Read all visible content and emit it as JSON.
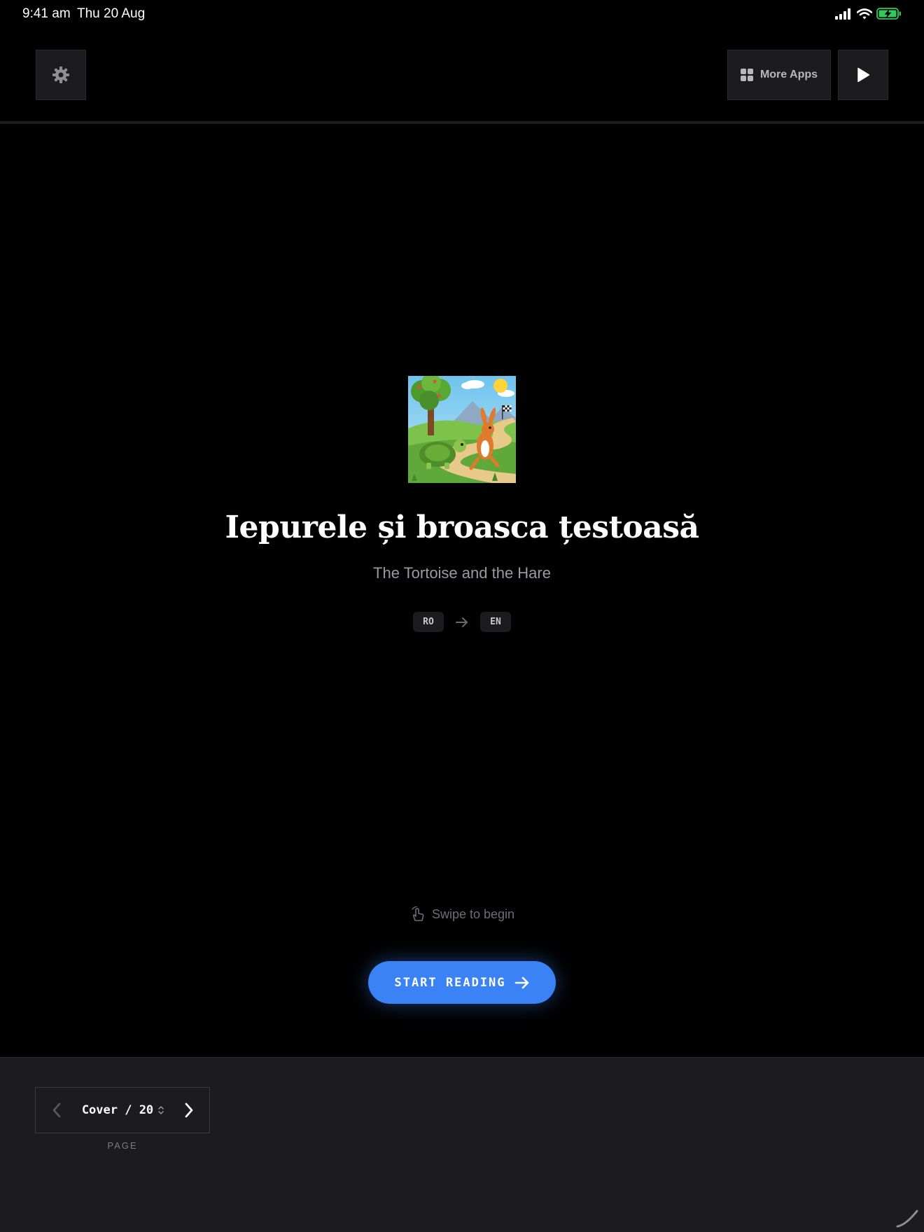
{
  "status_bar": {
    "time": "9:41 am",
    "date": "Thu 20 Aug",
    "icons": [
      "cellular-signal-icon",
      "wifi-icon",
      "battery-charging-icon"
    ]
  },
  "toolbar": {
    "settings_icon": "gear-icon",
    "more_apps_label": "More Apps",
    "more_apps_icon": "grid-icon",
    "play_icon": "play-icon"
  },
  "cover": {
    "title": "Iepurele și broasca țestoasă",
    "subtitle": "The Tortoise and the Hare",
    "source_language": "RO",
    "target_language": "EN",
    "swipe_hint": "Swipe to begin",
    "start_button_label": "START READING"
  },
  "pager": {
    "current_label": "Cover / 20",
    "caption": "PAGE"
  },
  "colors": {
    "background": "#000000",
    "accent": "#3b82f6",
    "panel": "#1c1c1e"
  }
}
